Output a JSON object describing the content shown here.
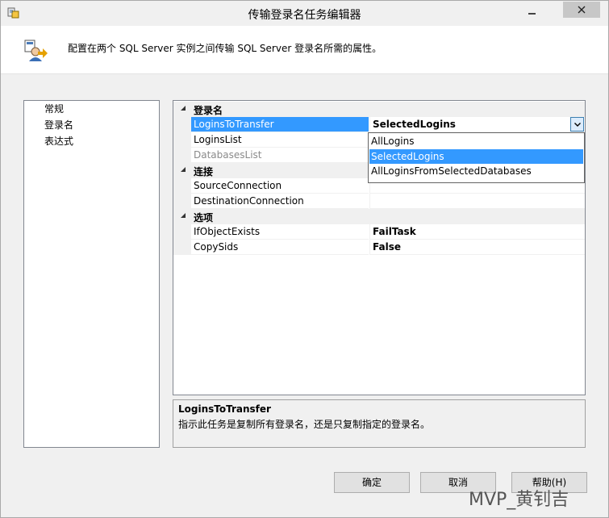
{
  "window": {
    "title": "传输登录名任务编辑器"
  },
  "header": {
    "description": "配置在两个 SQL Server 实例之间传输 SQL Server 登录名所需的属性。"
  },
  "nav": {
    "items": [
      {
        "label": "常规"
      },
      {
        "label": "登录名"
      },
      {
        "label": "表达式"
      }
    ]
  },
  "grid": {
    "categories": [
      {
        "label": "登录名"
      },
      {
        "label": "连接"
      },
      {
        "label": "选项"
      }
    ],
    "properties": {
      "logins_to_transfer": {
        "name": "LoginsToTransfer",
        "value": "SelectedLogins"
      },
      "logins_list": {
        "name": "LoginsList",
        "value": ""
      },
      "databases_list": {
        "name": "DatabasesList",
        "value": ""
      },
      "source_connection": {
        "name": "SourceConnection",
        "value": ""
      },
      "destination_connection": {
        "name": "DestinationConnection",
        "value": ""
      },
      "if_object_exists": {
        "name": "IfObjectExists",
        "value": "FailTask"
      },
      "copy_sids": {
        "name": "CopySids",
        "value": "False"
      }
    }
  },
  "dropdown": {
    "options": [
      {
        "label": "AllLogins"
      },
      {
        "label": "SelectedLogins"
      },
      {
        "label": "AllLoginsFromSelectedDatabases"
      }
    ],
    "selected": "SelectedLogins"
  },
  "description_panel": {
    "title": "LoginsToTransfer",
    "text": "指示此任务是复制所有登录名，还是只复制指定的登录名。"
  },
  "buttons": {
    "ok": "确定",
    "cancel": "取消",
    "help": "帮助(H)"
  },
  "watermark": "MVP_黄钊吉",
  "colors": {
    "selection": "#3399ff",
    "close_button": "#c7c7c7"
  }
}
